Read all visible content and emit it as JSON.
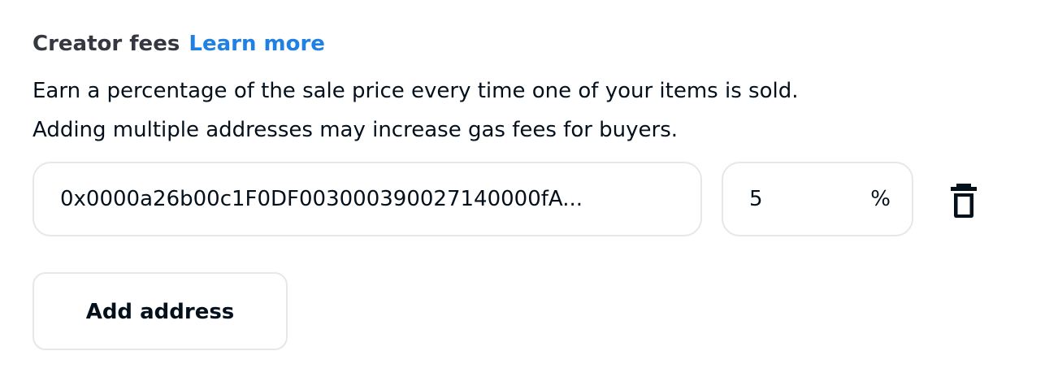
{
  "section": {
    "title": "Creator fees",
    "learn_more": "Learn more",
    "description_line1": "Earn a percentage of the sale price every time one of your items is sold.",
    "description_line2": "Adding multiple addresses may increase gas fees for buyers."
  },
  "fee_row": {
    "address": "0x0000a26b00c1F0DF003000390027140000fA...",
    "percent": "5",
    "percent_suffix": "%",
    "delete_icon": "trash-icon"
  },
  "add_address_label": "Add address",
  "colors": {
    "link": "#2081e2",
    "border": "#e5e8eb",
    "text": "#04111d",
    "heading": "#353840"
  }
}
